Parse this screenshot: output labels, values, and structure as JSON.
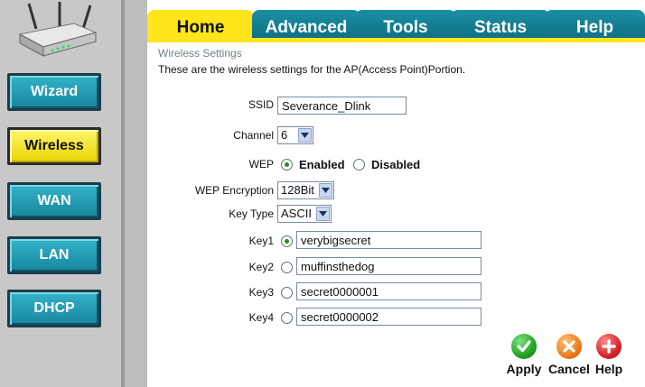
{
  "nav": {
    "items": [
      {
        "label": "Wizard",
        "active": false
      },
      {
        "label": "Wireless",
        "active": true
      },
      {
        "label": "WAN",
        "active": false
      },
      {
        "label": "LAN",
        "active": false
      },
      {
        "label": "DHCP",
        "active": false
      }
    ]
  },
  "tabs": [
    {
      "label": "Home",
      "active": true
    },
    {
      "label": "Advanced",
      "active": false
    },
    {
      "label": "Tools",
      "active": false
    },
    {
      "label": "Status",
      "active": false
    },
    {
      "label": "Help",
      "active": false
    }
  ],
  "section": {
    "title": "Wireless Settings",
    "description": "These are the wireless settings for the AP(Access Point)Portion."
  },
  "form": {
    "ssid_label": "SSID",
    "ssid_value": "Severance_Dlink",
    "channel_label": "Channel",
    "channel_value": "6",
    "wep_label": "WEP",
    "wep_enabled_label": "Enabled",
    "wep_disabled_label": "Disabled",
    "wep_selected": "Enabled",
    "wep_encryption_label": "WEP Encryption",
    "wep_encryption_value": "128Bit",
    "key_type_label": "Key Type",
    "key_type_value": "ASCII",
    "selected_key": "Key1",
    "keys": [
      {
        "label": "Key1",
        "value": "verybigsecret"
      },
      {
        "label": "Key2",
        "value": "muffinsthedog"
      },
      {
        "label": "Key3",
        "value": "secret0000001"
      },
      {
        "label": "Key4",
        "value": "secret0000002"
      }
    ]
  },
  "actions": {
    "apply_label": "Apply",
    "cancel_label": "Cancel",
    "help_label": "Help"
  },
  "colors": {
    "tab_active": "#ffe51a",
    "tab_inactive": "#1b8fa5",
    "nav_active": "#fff56a",
    "nav_inactive": "#17869c",
    "apply": "#1fa51f",
    "cancel": "#f07c1a",
    "help": "#d8262a"
  }
}
